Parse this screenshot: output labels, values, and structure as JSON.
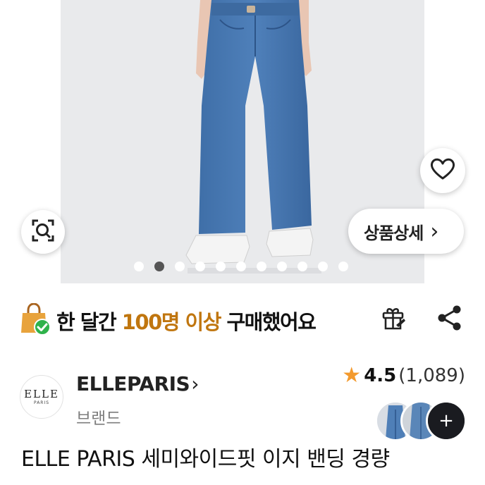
{
  "actions": {
    "detail_label": "상품상세",
    "detail_chevron": "›"
  },
  "gallery": {
    "total_images": 11,
    "active_index": 1
  },
  "purchase_info": {
    "prefix": "한 달간 ",
    "highlight": "100명 이상",
    "suffix": " 구매했어요",
    "highlight_color": "#c0760f"
  },
  "brand": {
    "logo_text": "ELLE",
    "logo_sub": "PARIS",
    "name": "ELLEPARIS",
    "chevron": "›",
    "type": "브랜드"
  },
  "rating": {
    "star": "★",
    "score": "4.5",
    "count": "(1,089)",
    "star_color": "#f39a2e"
  },
  "review_thumbs": {
    "more": "+"
  },
  "product": {
    "title": "ELLE PARIS 세미와이드핏 이지 밴딩 경량"
  },
  "icons": {
    "wishlist": "heart-icon",
    "zoom": "zoom-search-icon",
    "bag": "shopping-bag-check-icon",
    "gift": "gift-icon",
    "share": "share-icon"
  }
}
